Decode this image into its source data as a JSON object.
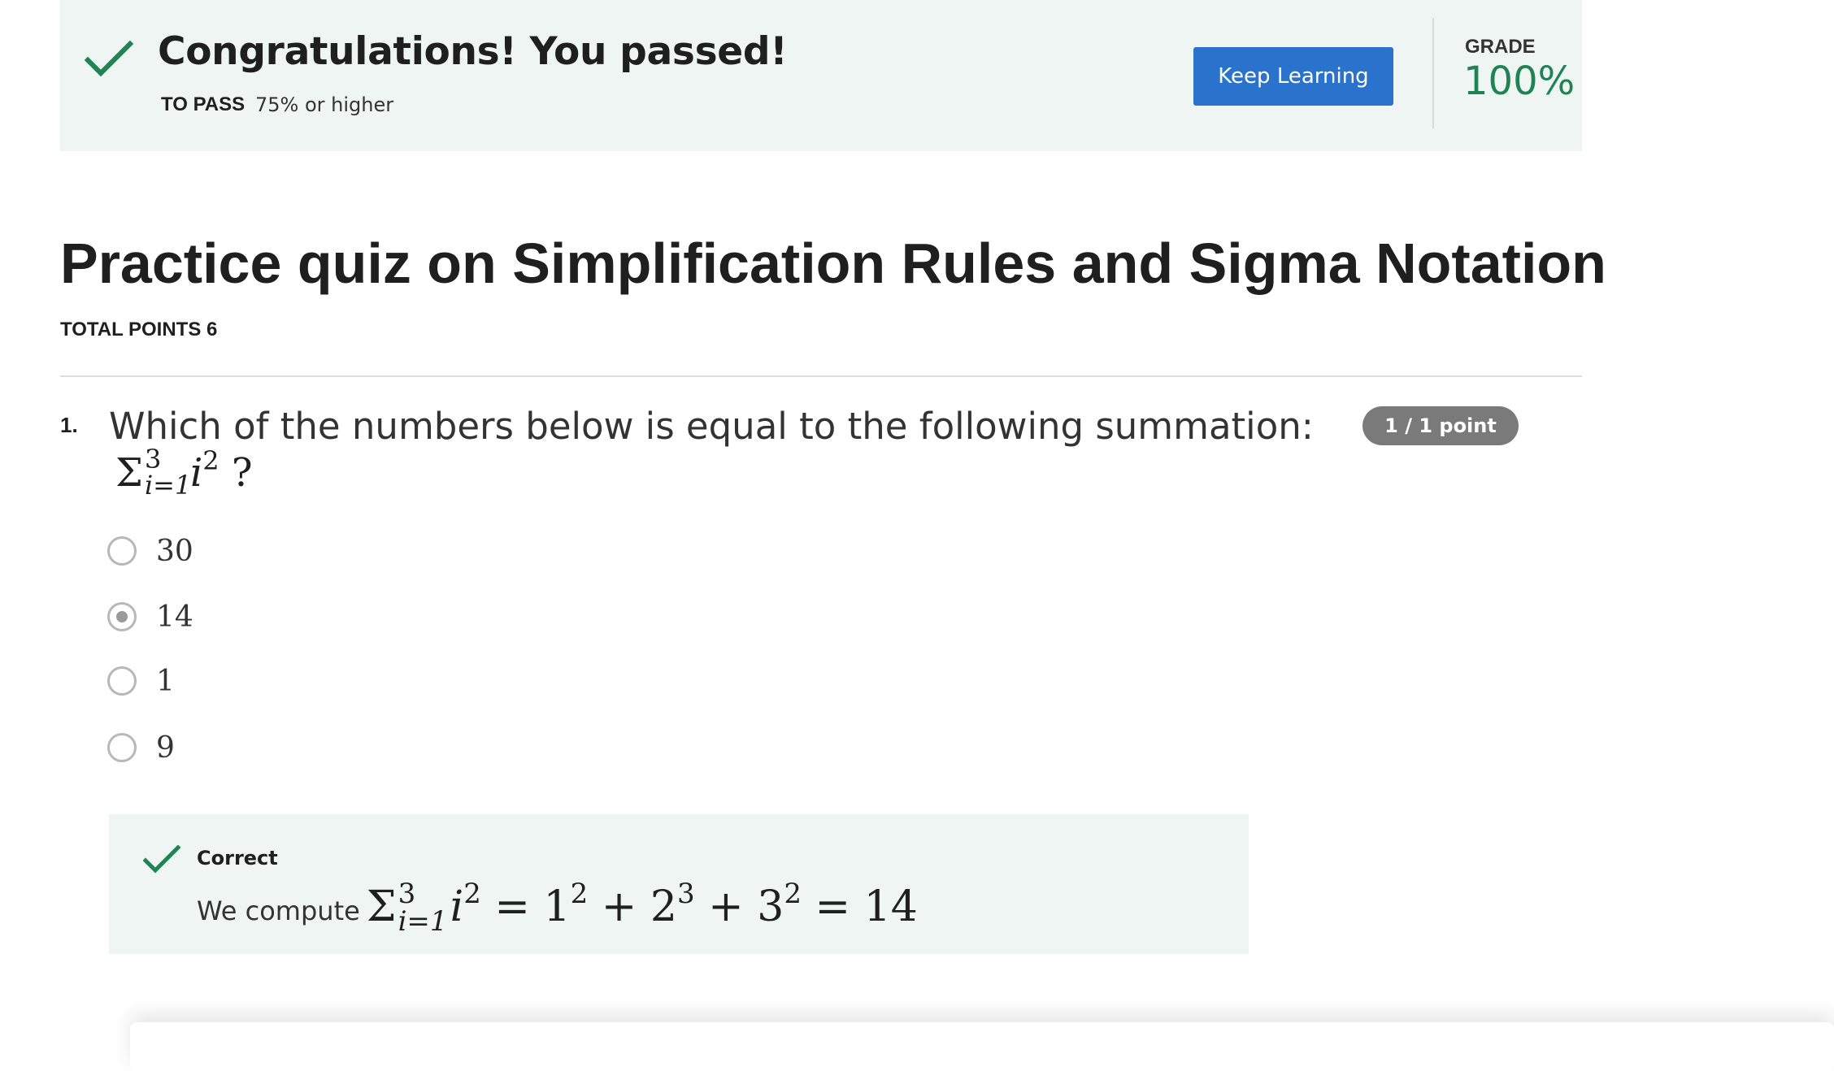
{
  "banner": {
    "title": "Congratulations! You passed!",
    "to_pass_label": "TO PASS",
    "to_pass_value": "75% or higher",
    "keep_learning_label": "Keep Learning",
    "grade_label": "GRADE",
    "grade_value": "100%",
    "success_color": "#1f8354",
    "button_color": "#2a73cc"
  },
  "quiz": {
    "title": "Practice quiz on Simplification Rules and Sigma Notation",
    "total_points": "TOTAL POINTS 6"
  },
  "question": {
    "number": "1.",
    "text": "Which of the numbers below is equal to the following summation:",
    "math": {
      "sigma": "Σ",
      "upper": "3",
      "lower": "i=1",
      "variable": "i",
      "exponent": "2",
      "suffix": "?"
    },
    "score": "1 / 1 point",
    "options": [
      {
        "label": "30",
        "selected": false
      },
      {
        "label": "14",
        "selected": true
      },
      {
        "label": "1",
        "selected": false
      },
      {
        "label": "9",
        "selected": false
      }
    ]
  },
  "feedback": {
    "status": "Correct",
    "lead": "We compute",
    "math": {
      "sigma": "Σ",
      "upper": "3",
      "lower": "i=1",
      "variable": "i",
      "exponent": "2",
      "eq1": "=",
      "t1_base": "1",
      "t1_exp": "2",
      "plus1": "+",
      "t2_base": "2",
      "t2_exp": "3",
      "plus2": "+",
      "t3_base": "3",
      "t3_exp": "2",
      "eq2": "=",
      "result": "14"
    }
  },
  "icons": {
    "banner_check": "check-icon",
    "feedback_check": "check-icon"
  }
}
